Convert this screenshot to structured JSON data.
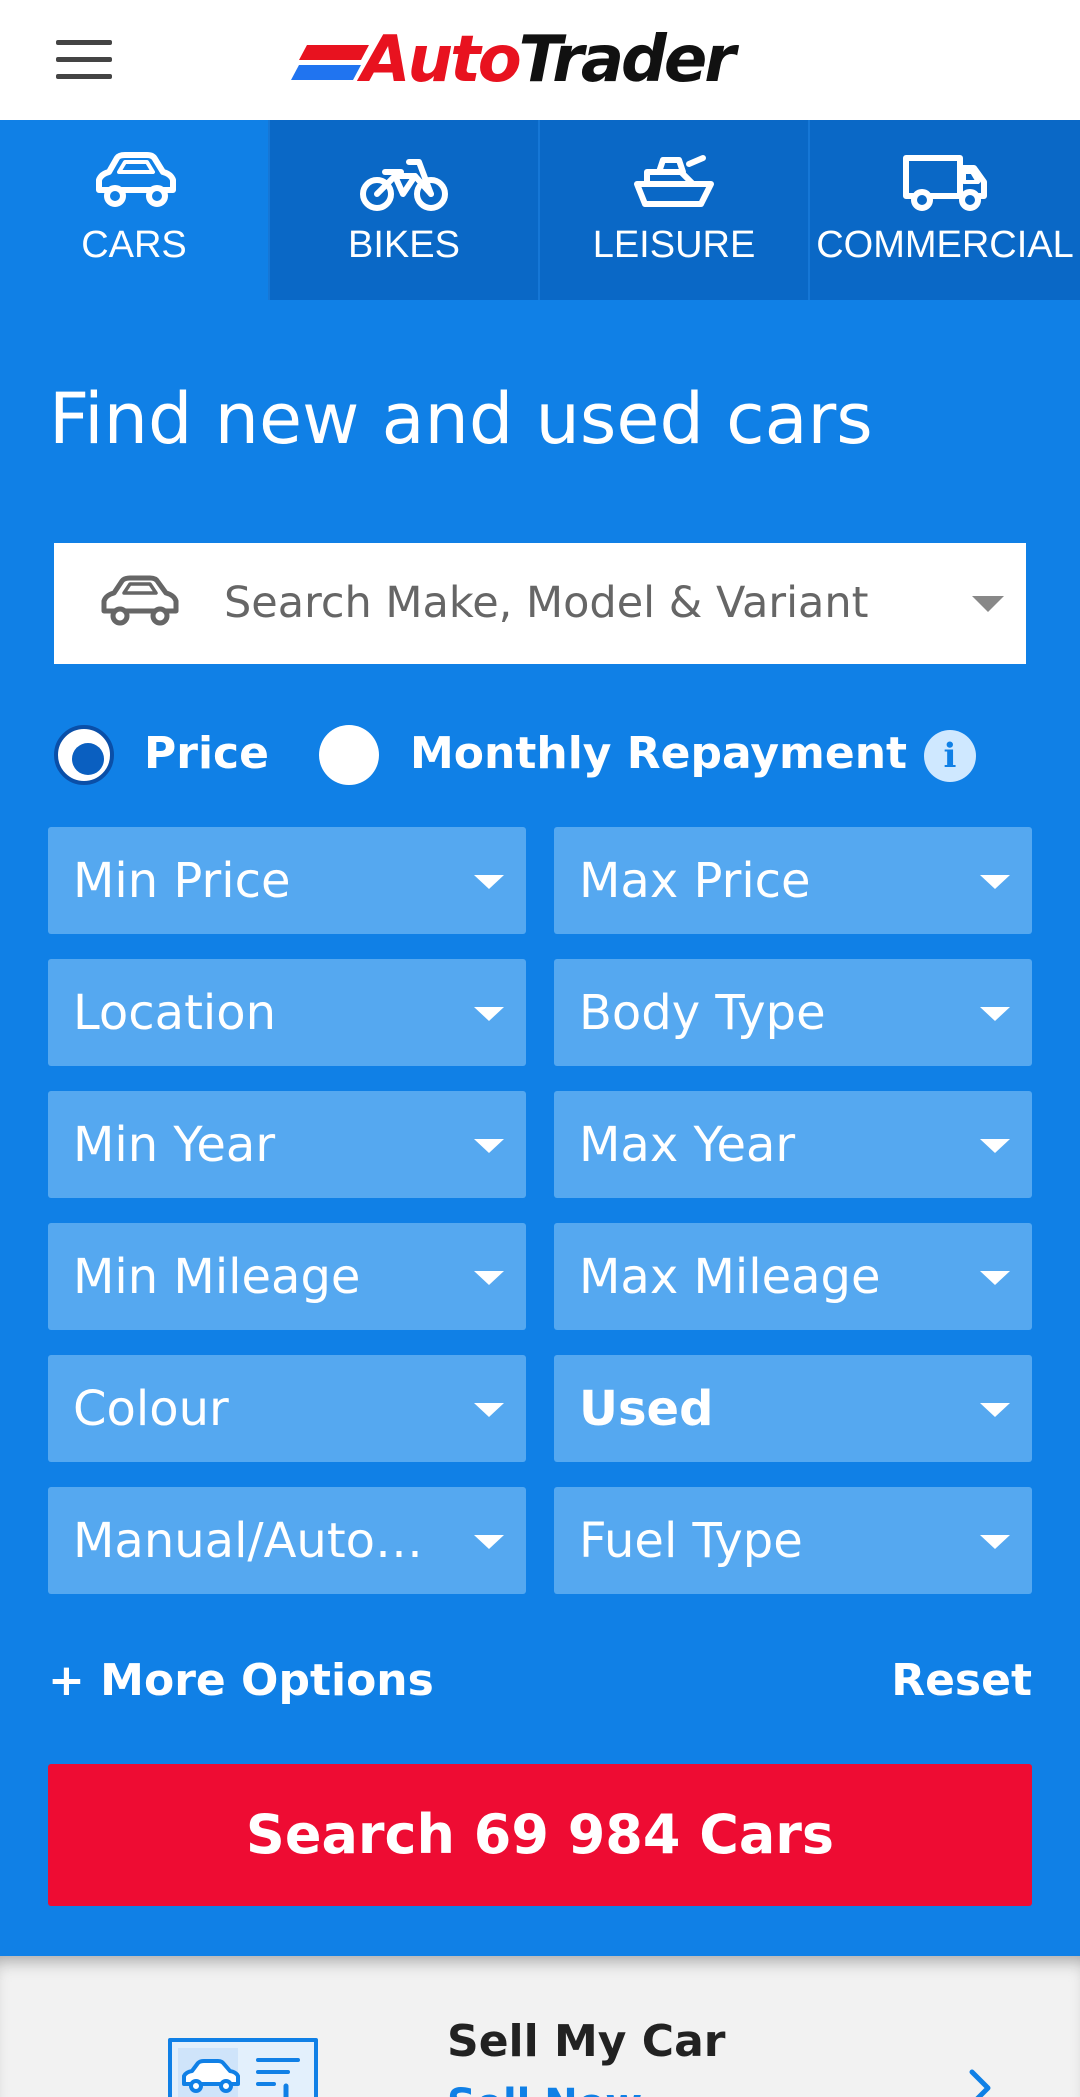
{
  "header": {
    "logo_part1": "Auto",
    "logo_part2": "Trader",
    "logo_text": "AutoTrader"
  },
  "tabs": [
    {
      "label": "CARS",
      "icon": "car-icon",
      "active": true
    },
    {
      "label": "BIKES",
      "icon": "bike-icon",
      "active": false
    },
    {
      "label": "LEISURE",
      "icon": "boat-icon",
      "active": false
    },
    {
      "label": "COMMERCIAL",
      "icon": "van-icon",
      "active": false
    }
  ],
  "main": {
    "title": "Find new and used cars",
    "search_placeholder": "Search Make, Model & Variant",
    "radio_price": "Price",
    "radio_monthly": "Monthly Repayment",
    "selected_radio": "Price",
    "filters": [
      {
        "label": "Min Price",
        "bold": false
      },
      {
        "label": "Max Price",
        "bold": false
      },
      {
        "label": "Location",
        "bold": false
      },
      {
        "label": "Body Type",
        "bold": false
      },
      {
        "label": "Min Year",
        "bold": false
      },
      {
        "label": "Max Year",
        "bold": false
      },
      {
        "label": "Min Mileage",
        "bold": false
      },
      {
        "label": "Max Mileage",
        "bold": false
      },
      {
        "label": "Colour",
        "bold": false
      },
      {
        "label": "Used",
        "bold": true
      },
      {
        "label": "Manual/Automatic",
        "bold": false
      },
      {
        "label": "Fuel Type",
        "bold": false
      }
    ],
    "more_options": "+ More Options",
    "reset": "Reset",
    "search_button": "Search 69 984 Cars"
  },
  "sell_card": {
    "title": "Sell My Car",
    "subtitle": "Sell Now"
  },
  "colors": {
    "brand_blue": "#1080e6",
    "tab_dark": "#0a68c6",
    "select_bg": "#55a8f0",
    "search_red": "#ee0c33",
    "logo_red": "#e8121f"
  }
}
